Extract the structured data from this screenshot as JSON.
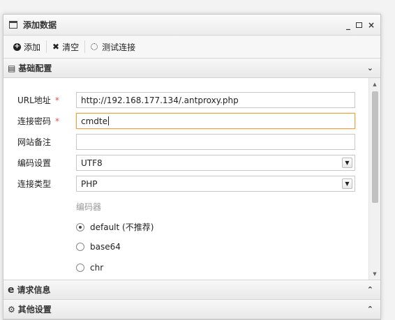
{
  "window": {
    "title": "添加数据",
    "controls": {
      "minimize": "_",
      "close": "×"
    }
  },
  "toolbar": {
    "add_label": "添加",
    "add_icon": "+",
    "clear_label": "清空",
    "clear_icon": "✖",
    "test_label": "测试连接"
  },
  "sections": {
    "basic": {
      "title": "基础配置",
      "chevron": "⌄"
    },
    "request": {
      "title": "请求信息",
      "icon": "e",
      "chevron": "⌃"
    },
    "other": {
      "title": "其他设置",
      "icon": "⚙",
      "chevron": "⌃"
    }
  },
  "form": {
    "url": {
      "label": "URL地址",
      "required": "*",
      "value": "http://192.168.177.134/.antproxy.php"
    },
    "password": {
      "label": "连接密码",
      "required": "*",
      "value": "cmdte"
    },
    "note": {
      "label": "网站备注",
      "value": ""
    },
    "encoding": {
      "label": "编码设置",
      "value": "UTF8"
    },
    "type": {
      "label": "连接类型",
      "value": "PHP"
    },
    "encoder": {
      "label": "编码器",
      "options": [
        {
          "label": "default (不推荐)",
          "selected": true
        },
        {
          "label": "base64",
          "selected": false
        },
        {
          "label": "chr",
          "selected": false
        }
      ]
    }
  }
}
